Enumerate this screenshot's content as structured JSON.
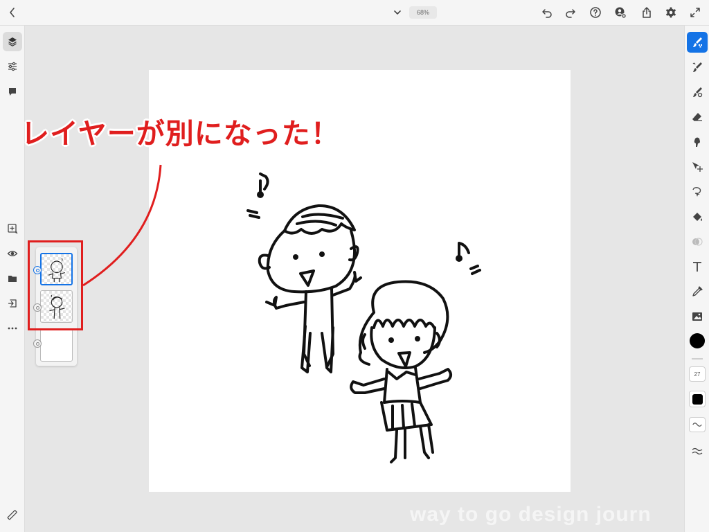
{
  "topbar": {
    "back_icon": "chevron-left-icon",
    "doc_menu_icon": "chevron-down-icon",
    "zoom_level": "68%",
    "right_icons": [
      "undo-icon",
      "redo-icon",
      "help-icon",
      "share-user-icon",
      "export-icon",
      "settings-icon",
      "fullscreen-icon"
    ]
  },
  "left_toolbar": {
    "top_icons": [
      "layers-icon",
      "properties-icon",
      "comment-icon"
    ],
    "layer_icons": [
      "add-layer-icon",
      "visibility-icon",
      "group-icon",
      "import-icon",
      "more-icon"
    ],
    "bottom_icon": "ruler-icon"
  },
  "right_toolbar": {
    "tools": [
      "pixel-brush-icon",
      "live-brush-icon",
      "vector-brush-icon",
      "eraser-icon",
      "smudge-icon",
      "move-transform-icon",
      "lasso-icon",
      "fill-icon",
      "clone-icon",
      "text-icon",
      "eyedropper-icon",
      "image-icon"
    ],
    "color": "#000000",
    "brush_size": "27",
    "opacity_color": "#000000",
    "smoothing_icon": "wave-icon",
    "brush_settings_icon": "brush-settings-icon"
  },
  "annotation": {
    "callout_text": "レイヤーが別になった！",
    "color": "#e01e1e"
  },
  "layers": [
    {
      "name": "girl-layer",
      "selected": true
    },
    {
      "name": "boy-layer",
      "selected": false
    },
    {
      "name": "background-layer",
      "selected": false
    }
  ],
  "watermark": "way to go design journ",
  "accent_color": "#1473e6"
}
